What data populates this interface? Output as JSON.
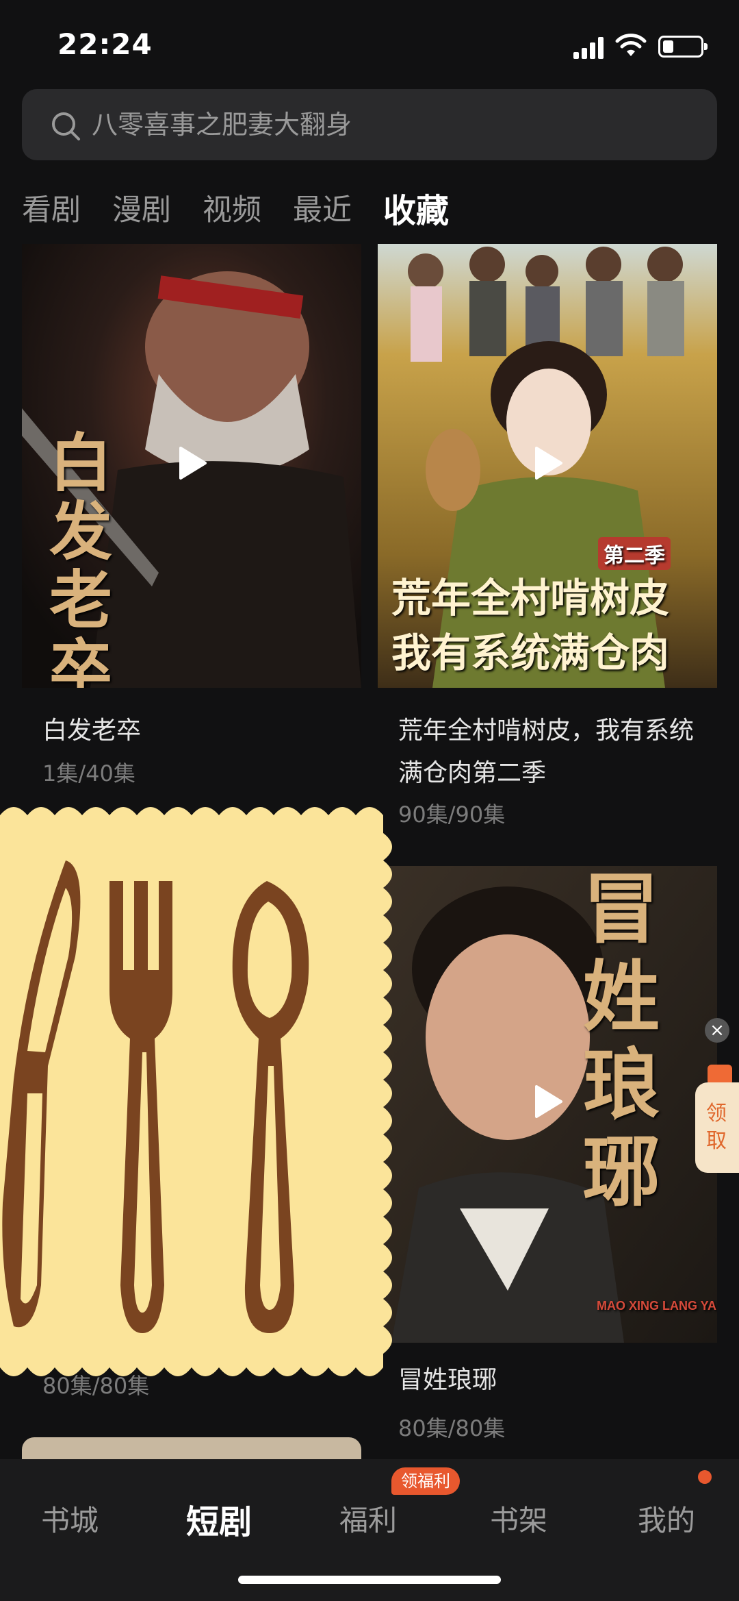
{
  "status_bar": {
    "time": "22:24",
    "battery_level": 0.28
  },
  "search": {
    "placeholder": "八零喜事之肥妻大翻身"
  },
  "tabs": [
    {
      "label": "看剧"
    },
    {
      "label": "漫剧"
    },
    {
      "label": "视频"
    },
    {
      "label": "最近"
    },
    {
      "label": "收藏",
      "active": true
    }
  ],
  "cards": [
    {
      "title": "白发老卒",
      "count": "1集/40集",
      "poster_text": "白发老卒"
    },
    {
      "title": "荒年全村啃树皮，我有系统满仓肉第二季",
      "count": "90集/90集",
      "poster_text_top": "荒年全村啃树皮",
      "poster_text_bottom": "我有系统满仓肉",
      "poster_badge": "第二季"
    },
    {
      "title": "",
      "count": "80集/80集"
    },
    {
      "title": "冒姓琅琊",
      "count": "80集/80集",
      "poster_text": "冒姓琅琊",
      "poster_subtext": "MAO XING LANG YA"
    }
  ],
  "float_widget": {
    "close": "×",
    "label": "领取"
  },
  "bottom_nav": {
    "items": [
      {
        "label": "书城"
      },
      {
        "label": "短剧",
        "active": true
      },
      {
        "label": "福利"
      },
      {
        "label": "书架"
      },
      {
        "label": "我的"
      }
    ],
    "badge": "领福利"
  },
  "colors": {
    "background": "#111112",
    "accent": "#e8582e",
    "sticker": "#fbe49a",
    "sticker_ink": "#7a4420"
  }
}
